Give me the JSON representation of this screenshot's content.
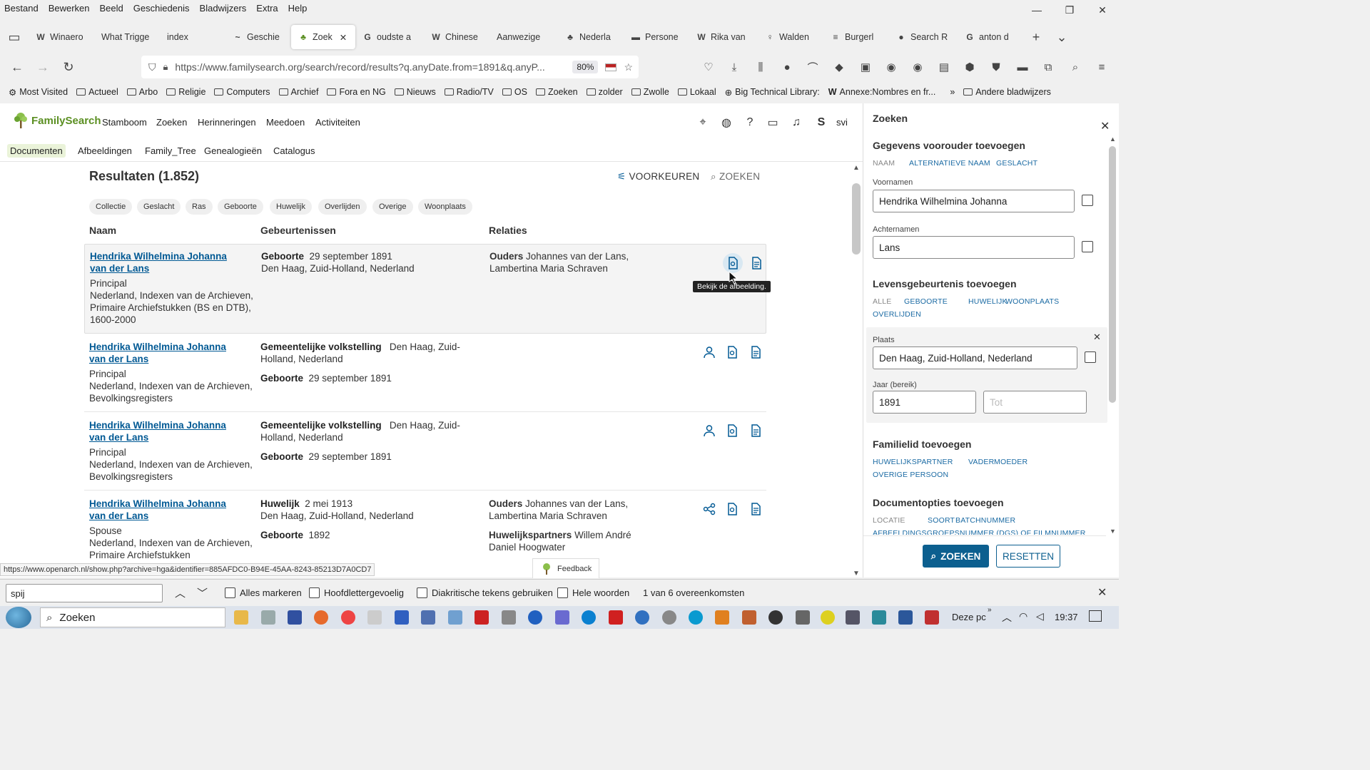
{
  "menubar": [
    "Bestand",
    "Bewerken",
    "Beeld",
    "Geschiedenis",
    "Bladwijzers",
    "Extra",
    "Help"
  ],
  "tabs": [
    {
      "label": "Winaero",
      "icon": "W"
    },
    {
      "label": "What Trigge",
      "icon": ""
    },
    {
      "label": "index",
      "icon": ""
    },
    {
      "label": "Geschie",
      "icon": "~"
    },
    {
      "label": "Zoek",
      "icon": "♣",
      "active": true
    },
    {
      "label": "oudste a",
      "icon": "G"
    },
    {
      "label": "Chinese",
      "icon": "W"
    },
    {
      "label": "Aanwezige",
      "icon": ""
    },
    {
      "label": "Nederla",
      "icon": "♣"
    },
    {
      "label": "Persone",
      "icon": "▬"
    },
    {
      "label": "Rika van",
      "icon": "W"
    },
    {
      "label": "Walden",
      "icon": "♀"
    },
    {
      "label": "Burgerl",
      "icon": "≡"
    },
    {
      "label": "Search R",
      "icon": "●"
    },
    {
      "label": "anton d",
      "icon": "G"
    }
  ],
  "url": "https://www.familysearch.org/search/record/results?q.anyDate.from=1891&q.anyP...",
  "zoom": "80%",
  "bookmarks": [
    "Most Visited",
    "Actueel",
    "Arbo",
    "Religie",
    "Computers",
    "Archief",
    "Fora en NG",
    "Nieuws",
    "Radio/TV",
    "OS",
    "Zoeken",
    "zolder",
    "Zwolle",
    "Lokaal",
    "Big Technical Library:",
    "Annexe:Nombres en fr...",
    "Andere bladwijzers"
  ],
  "fs": {
    "logo": "FamilySearch",
    "nav": [
      "Stamboom",
      "Zoeken",
      "Herinneringen",
      "Meedoen",
      "Activiteiten"
    ],
    "user_initial": "S",
    "user_name": "svi",
    "subnav": [
      "Documenten",
      "Afbeeldingen",
      "Family_Tree",
      "Genealogieën",
      "Catalogus"
    ]
  },
  "results": {
    "title": "Resultaten (1.852)",
    "prefs": "VOORKEUREN",
    "search": "ZOEKEN",
    "chips": [
      "Collectie",
      "Geslacht",
      "Ras",
      "Geboorte",
      "Huwelijk",
      "Overlijden",
      "Overige",
      "Woonplaats"
    ],
    "col_name": "Naam",
    "col_events": "Gebeurtenissen",
    "col_relations": "Relaties",
    "rows": [
      {
        "name1": "Hendrika Wilhelmina Johanna",
        "name2": "van der Lans",
        "role": "Principal",
        "coll": "Nederland, Indexen van de Archieven, Primaire Archiefstukken (BS en DTB), 1600-2000",
        "ev1_type": "Geboorte",
        "ev1_val": "29 september 1891",
        "ev1_place": "Den Haag, Zuid-Holland, Nederland",
        "rel1_type": "Ouders",
        "rel1_val": "Johannes van der Lans, Lambertina Maria Schraven"
      },
      {
        "name1": "Hendrika Wilhelmina Johanna",
        "name2": "van der Lans",
        "role": "Principal",
        "coll": "Nederland, Indexen van de Archieven, Bevolkingsregisters",
        "ev1_type": "Gemeentelijke volkstelling",
        "ev1_val": "Den Haag, Zuid-Holland, Nederland",
        "ev2_type": "Geboorte",
        "ev2_val": "29 september 1891"
      },
      {
        "name1": "Hendrika Wilhelmina Johanna",
        "name2": "van der Lans",
        "role": "Principal",
        "coll": "Nederland, Indexen van de Archieven, Bevolkingsregisters",
        "ev1_type": "Gemeentelijke volkstelling",
        "ev1_val": "Den Haag, Zuid-Holland, Nederland",
        "ev2_type": "Geboorte",
        "ev2_val": "29 september 1891"
      },
      {
        "name1": "Hendrika Wilhelmina Johanna",
        "name2": "van der Lans",
        "role": "Spouse",
        "coll": "Nederland, Indexen van de Archieven, Primaire Archiefstukken",
        "ev1_type": "Huwelijk",
        "ev1_val": "2 mei 1913",
        "ev1_place": "Den Haag, Zuid-Holland, Nederland",
        "ev2_type": "Geboorte",
        "ev2_val": "1892",
        "rel1_type": "Ouders",
        "rel1_val": "Johannes van der Lans, Lambertina Maria Schraven",
        "rel2_type": "Huwelijkspartners",
        "rel2_val": "Willem André Daniel Hoogwater"
      }
    ],
    "tooltip": "Bekijk de afbeelding.",
    "feedback": "Feedback",
    "status_url": "https://www.openarch.nl/show.php?archive=hga&identifier=885AFDC0-B94E-45AA-8243-85213D7A0CD7"
  },
  "sidebar": {
    "title": "Zoeken",
    "ancestor_title": "Gegevens voorouder toevoegen",
    "ancestor_links": [
      "NAAM",
      "ALTERNATIEVE NAAM",
      "GESLACHT"
    ],
    "first_label": "Voornamen",
    "first_value": "Hendrika Wilhelmina Johanna",
    "last_label": "Achternamen",
    "last_value": "Lans",
    "life_title": "Levensgebeurtenis toevoegen",
    "life_links": [
      "ALLE",
      "GEBOORTE",
      "HUWELIJK",
      "WOONPLAATS",
      "OVERLIJDEN"
    ],
    "place_label": "Plaats",
    "place_value": "Den Haag, Zuid-Holland, Nederland",
    "year_label": "Jaar (bereik)",
    "year_from": "1891",
    "year_to_placeholder": "Tot",
    "family_title": "Familielid toevoegen",
    "family_links": [
      "HUWELIJKSPARTNER",
      "VADER",
      "MOEDER",
      "OVERIGE PERSOON"
    ],
    "doc_title": "Documentopties toevoegen",
    "doc_links": [
      "LOCATIE",
      "SOORT",
      "BATCHNUMMER",
      "AFBEELDINGSGROEPSNUMMER (DGS) OF FILMNUMMER"
    ],
    "btn_search": "ZOEKEN",
    "btn_reset": "RESETTEN"
  },
  "findbar": {
    "value": "spij",
    "opt1": "Alles markeren",
    "opt2": "Hoofdlettergevoelig",
    "opt3": "Diakritische tekens gebruiken",
    "opt4": "Hele woorden",
    "matches": "1 van 6 overeenkomsten"
  },
  "taskbar": {
    "search": "Zoeken",
    "deze_pc": "Deze pc",
    "time": "19:37"
  },
  "colors": {
    "accent": "#005994",
    "brand": "#5b8f22",
    "button": "#0c5f8f"
  }
}
